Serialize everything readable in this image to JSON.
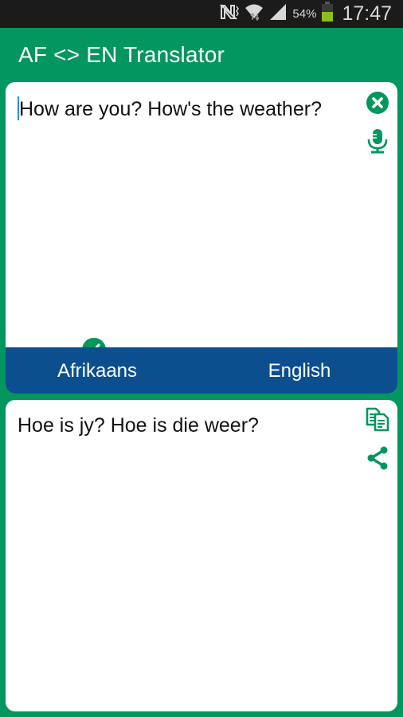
{
  "status_bar": {
    "icons": [
      "nfc-icon",
      "wifi-icon",
      "signal-icon",
      "battery-icon"
    ],
    "battery_percent": "54%",
    "time": "17:47"
  },
  "app_bar": {
    "title": "AF <> EN Translator"
  },
  "input_card": {
    "text": "How are you? How's the weather?",
    "clear_icon": "close-circle-icon",
    "mic_icon": "microphone-icon"
  },
  "language_bar": {
    "source_language": "Afrikaans",
    "target_language": "English",
    "selected": "Afrikaans"
  },
  "output_card": {
    "text": "Hoe is jy? Hoe is die weer?",
    "copy_icon": "copy-icon",
    "share_icon": "share-icon"
  },
  "colors": {
    "primary_green": "#03965e",
    "language_bar_blue": "#0c4f8f",
    "caret_blue": "#2b8be6"
  }
}
